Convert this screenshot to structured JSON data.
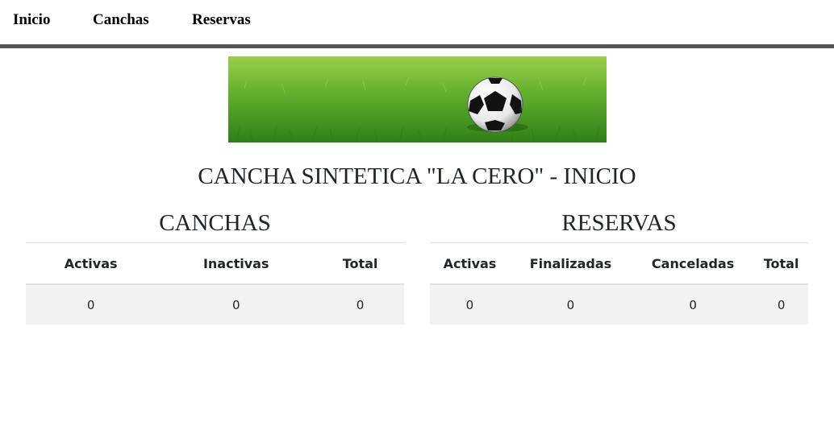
{
  "nav": {
    "inicio": "Inicio",
    "canchas": "Canchas",
    "reservas": "Reservas"
  },
  "page_title": "CANCHA SINTETICA \"LA CERO\" - INICIO",
  "canchas": {
    "heading": "CANCHAS",
    "columns": [
      "Activas",
      "Inactivas",
      "Total"
    ],
    "values": [
      "0",
      "0",
      "0"
    ]
  },
  "reservas": {
    "heading": "RESERVAS",
    "columns": [
      "Activas",
      "Finalizadas",
      "Canceladas",
      "Total"
    ],
    "values": [
      "0",
      "0",
      "0",
      "0"
    ]
  },
  "colors": {
    "nav_border": "#555555",
    "row_bg": "#f2f2f2",
    "grass": "#3f9a1f"
  },
  "banner_icon": "soccer-ball-on-grass"
}
